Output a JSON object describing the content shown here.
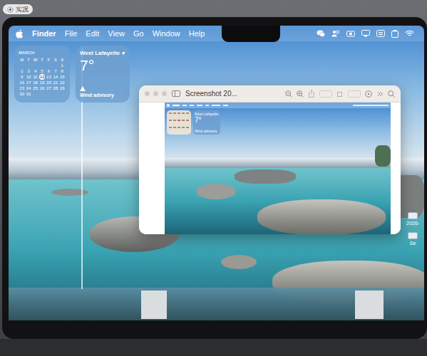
{
  "badge": {
    "label": "实况"
  },
  "menu_bar": {
    "app": "Finder",
    "items": [
      "File",
      "Edit",
      "View",
      "Go",
      "Window",
      "Help"
    ]
  },
  "widgets": {
    "calendar": {
      "month": "MARCH",
      "weekdays": [
        "M",
        "T",
        "W",
        "T",
        "F",
        "S",
        "S"
      ],
      "leading_blanks": 6,
      "days": [
        {
          "day": "1",
          "selected": false
        },
        {
          "day": "2",
          "selected": false
        },
        {
          "day": "3",
          "selected": false
        },
        {
          "day": "4",
          "selected": false
        },
        {
          "day": "5",
          "selected": false
        },
        {
          "day": "6",
          "selected": false
        },
        {
          "day": "7",
          "selected": false
        },
        {
          "day": "8",
          "selected": false
        },
        {
          "day": "9",
          "selected": false
        },
        {
          "day": "10",
          "selected": false
        },
        {
          "day": "11",
          "selected": false
        },
        {
          "day": "12",
          "selected": true
        },
        {
          "day": "13",
          "selected": false
        },
        {
          "day": "14",
          "selected": false
        },
        {
          "day": "15",
          "selected": false
        },
        {
          "day": "16",
          "selected": false
        },
        {
          "day": "17",
          "selected": false
        },
        {
          "day": "18",
          "selected": false
        },
        {
          "day": "19",
          "selected": false
        },
        {
          "day": "20",
          "selected": false
        },
        {
          "day": "21",
          "selected": false
        },
        {
          "day": "22",
          "selected": false
        },
        {
          "day": "23",
          "selected": false
        },
        {
          "day": "24",
          "selected": false
        },
        {
          "day": "25",
          "selected": false
        },
        {
          "day": "26",
          "selected": false
        },
        {
          "day": "27",
          "selected": false
        },
        {
          "day": "28",
          "selected": false
        },
        {
          "day": "29",
          "selected": false
        },
        {
          "day": "30",
          "selected": false
        },
        {
          "day": "31",
          "selected": false
        }
      ]
    },
    "weather": {
      "location": "West Lafayette",
      "temperature": "7°",
      "condition": "Wind advisory"
    }
  },
  "preview_window": {
    "title": "Screenshot 20...",
    "screenshot": {
      "weather": {
        "location": "West Lafayette",
        "temperature": "7°",
        "condition": "Wind advisory"
      }
    }
  },
  "desktop_items": [
    {
      "label": "2026-"
    },
    {
      "label": "Se"
    }
  ]
}
